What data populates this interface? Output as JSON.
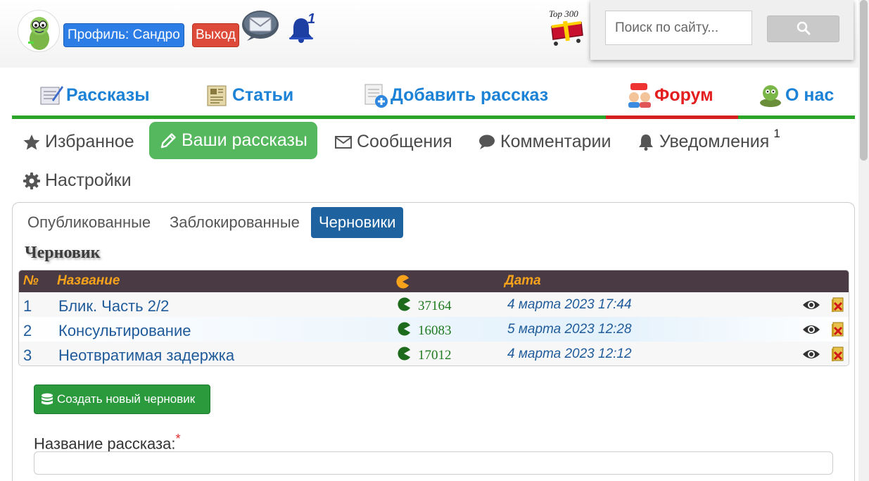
{
  "header": {
    "profile_label": "Профиль: Сандро",
    "exit_label": "Выход",
    "notification_count": "1",
    "top300_label": "Top 300"
  },
  "search": {
    "placeholder": "Поиск по сайту...",
    "button_icon": "search-icon"
  },
  "main_nav": [
    {
      "label": "Рассказы",
      "icon": "stories-icon"
    },
    {
      "label": "Статьи",
      "icon": "articles-icon"
    },
    {
      "label": "Добавить рассказ",
      "icon": "add-story-icon"
    },
    {
      "label": "Форум",
      "icon": "forum-icon"
    },
    {
      "label": "О нас",
      "icon": "about-icon"
    }
  ],
  "sub_nav": [
    {
      "label": "Избранное",
      "icon": "star-icon"
    },
    {
      "label": "Ваши рассказы",
      "icon": "pencil-icon",
      "active": true
    },
    {
      "label": "Сообщения",
      "icon": "envelope-icon"
    },
    {
      "label": "Комментарии",
      "icon": "comment-icon"
    },
    {
      "label": "Уведомления",
      "icon": "bell-icon",
      "badge": "1"
    },
    {
      "label": "Настройки",
      "icon": "gear-icon"
    }
  ],
  "pills": [
    {
      "label": "Опубликованные"
    },
    {
      "label": "Заблокированные"
    },
    {
      "label": "Черновики",
      "active": true
    }
  ],
  "section_title": "Черновик",
  "table": {
    "headers": {
      "num": "№",
      "title": "Название",
      "date": "Дата"
    },
    "rows": [
      {
        "num": "1",
        "title": "Блик. Часть 2/2",
        "count": "37164",
        "date": "4 марта 2023 17:44"
      },
      {
        "num": "2",
        "title": "Консультирование",
        "count": "16083",
        "date": "5 марта 2023 12:28"
      },
      {
        "num": "3",
        "title": "Неотвратимая задержка",
        "count": "17012",
        "date": "4 марта 2023 12:12"
      }
    ]
  },
  "create_button_label": "Создать новый черновик",
  "form": {
    "name_label": "Название рассказа:",
    "required_mark": "*"
  },
  "colors": {
    "brand_blue": "#1c82d6",
    "forum_red": "#e41e1e",
    "active_green": "#56b85e",
    "pill_active": "#1e63a0",
    "table_header": "#4a3a44",
    "table_header_text": "#f7a21b"
  }
}
